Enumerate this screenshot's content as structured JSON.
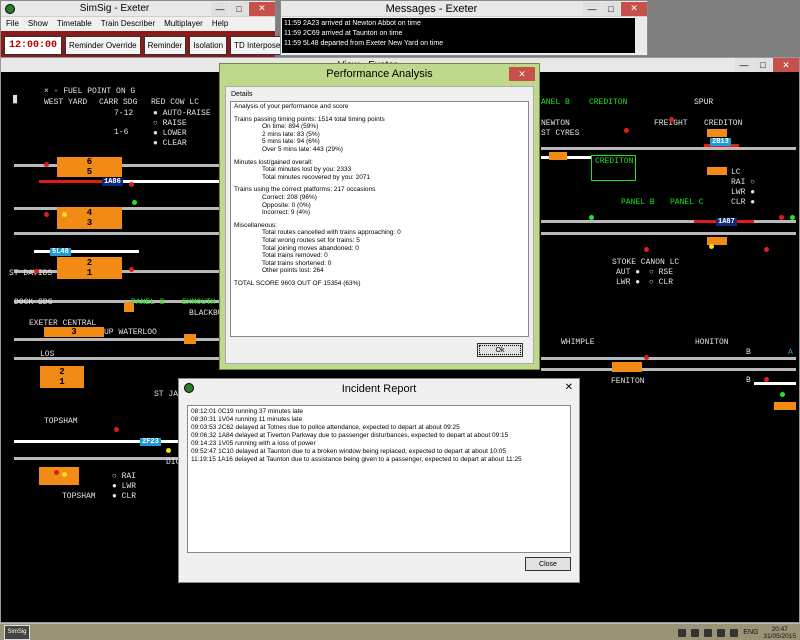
{
  "main_window": {
    "title": "SimSig - Exeter",
    "menu": [
      "File",
      "Show",
      "Timetable",
      "Train Describer",
      "Multiplayer",
      "Help"
    ],
    "clock": "12:00:00",
    "toolbar_buttons": [
      "Reminder Override",
      "Reminder",
      "Isolation",
      "TD Interpose"
    ]
  },
  "messages_window": {
    "title": "Messages - Exeter",
    "lines": [
      "11:59 2A23 arrived at Newton Abbot on time",
      "11:59 2C69 arrived at Taunton on time",
      "11:59 5L48 departed from Exeter New Yard on time"
    ]
  },
  "view_window": {
    "title": "View - Exeter",
    "labels": {
      "fuel_point": "× - FUEL POINT ON G",
      "west_yard": "WEST YARD",
      "carr_sdg": "CARR SDG",
      "red_cow_lc": "RED COW LC",
      "range_7_12": "7-12",
      "range_1_6": "1-6",
      "auto_raise": "AUTO-RAISE",
      "raise": "RAISE",
      "lower": "LOWER",
      "clear": "CLEAR",
      "st_davids": "ST DAVIDS",
      "dock_sdg": "DOCK SDG",
      "panel_b": "PANEL B",
      "exmouth": "EXMOUTH",
      "blackbu": "BLACKBU",
      "exeter_central": "EXETER CENTRAL",
      "up_waterloo": "UP WATERLOO",
      "los": "LOS",
      "st_ja": "ST JA",
      "topsham": "TOPSHAM",
      "topsham2": "TOPSHAM",
      "dig": "DIG",
      "rai_left": "RAI",
      "lwr_left": "LWR",
      "clr_left": "CLR",
      "anel_b": "ANEL B",
      "crediton": "CREDITON",
      "crediton_box": "CREDITON",
      "crediton2": "CREDITON",
      "spur": "SPUR",
      "newton": "NEWTON",
      "st_cyres": "ST CYRES",
      "freight": "FREIGHT",
      "panel_c": "PANEL C",
      "stoke_canon_lc": "STOKE CANON LC",
      "aut": "AUT",
      "rse": "RSE",
      "lwr_right": "LWR",
      "clr_right": "CLR",
      "lc": "LC",
      "rai_right": "RAI",
      "lwr_right2": "LWR",
      "clr_right2": "CLR",
      "whimple": "WHIMPLE",
      "honiton": "HONITON",
      "feniton": "FENITON",
      "b1": "B",
      "b2": "B",
      "a": "A"
    },
    "platforms": [
      "6",
      "5",
      "4",
      "3",
      "2",
      "1",
      "3",
      "2",
      "1"
    ],
    "berths": [
      "1A86",
      "5L48",
      "2B13",
      "1A87",
      "2F23"
    ]
  },
  "performance_dialog": {
    "title": "Performance Analysis",
    "details_label": "Details",
    "lines": [
      {
        "t": "Analysis of your performance and score",
        "i": 0
      },
      {
        "t": "",
        "i": -1
      },
      {
        "t": "Trains passing timing points: 1514 total timing points",
        "i": 0
      },
      {
        "t": "On time: 894 (59%)",
        "i": 1
      },
      {
        "t": "2 mins late: 83 (5%)",
        "i": 1
      },
      {
        "t": "5 mins late: 94 (6%)",
        "i": 1
      },
      {
        "t": "Over 5 mins late: 443 (29%)",
        "i": 1
      },
      {
        "t": "",
        "i": -1
      },
      {
        "t": "Minutes lost/gained overall:",
        "i": 0
      },
      {
        "t": "Total minutes lost by you: 2333",
        "i": 1
      },
      {
        "t": "Total minutes recovered by you: 2071",
        "i": 1
      },
      {
        "t": "",
        "i": -1
      },
      {
        "t": "Trains using the correct platforms: 217 occasions",
        "i": 0
      },
      {
        "t": "Correct: 208 (96%)",
        "i": 1
      },
      {
        "t": "Opposite: 0 (0%)",
        "i": 1
      },
      {
        "t": "Incorrect: 9 (4%)",
        "i": 1
      },
      {
        "t": "",
        "i": -1
      },
      {
        "t": "Miscellaneous:",
        "i": 0
      },
      {
        "t": "Total routes cancelled with trains approaching: 0",
        "i": 1
      },
      {
        "t": "Total wrong routes set for trains: 5",
        "i": 1
      },
      {
        "t": "Total joining moves abandoned: 0",
        "i": 1
      },
      {
        "t": "Total trains removed: 0",
        "i": 1
      },
      {
        "t": "Total trains shortened: 0",
        "i": 1
      },
      {
        "t": "Other points lost: 264",
        "i": 1
      },
      {
        "t": "",
        "i": -1
      },
      {
        "t": "TOTAL SCORE 9603 OUT OF 15354 (63%)",
        "i": 0
      }
    ],
    "ok_label": "Ok"
  },
  "incident_dialog": {
    "title": "Incident Report",
    "lines": [
      "08:12:01 0C19 running 37 minutes late",
      "08:30:31 1V04 running 11 minutes late",
      "09:03:53 2C62 delayed at Totnes due to police attendance, expected to depart at about 09:25",
      "09:06:32 1A84 delayed at Tiverton Parkway due to passenger disturbances, expected to depart at about 09:15",
      "09:14:23 1V05 running with a loss of power",
      "09:52:47 1C10 delayed at Taunton due to a broken window being replaced, expected to depart at about 10:05",
      "11:19:15 1A16 delayed at Taunton due to assistance being given to a passenger, expected to depart at about 11:25"
    ],
    "close_label": "Close"
  },
  "taskbar": {
    "app_label": "SimSig",
    "language": "ENG",
    "time": "20:47",
    "date": "31/05/2015"
  },
  "colors": {
    "platform": "#f28a16",
    "signal_red": "#e21b1b",
    "signal_green": "#23e523",
    "dialog_frame": "#bfd98c",
    "toolbar": "#8b1a1a"
  }
}
